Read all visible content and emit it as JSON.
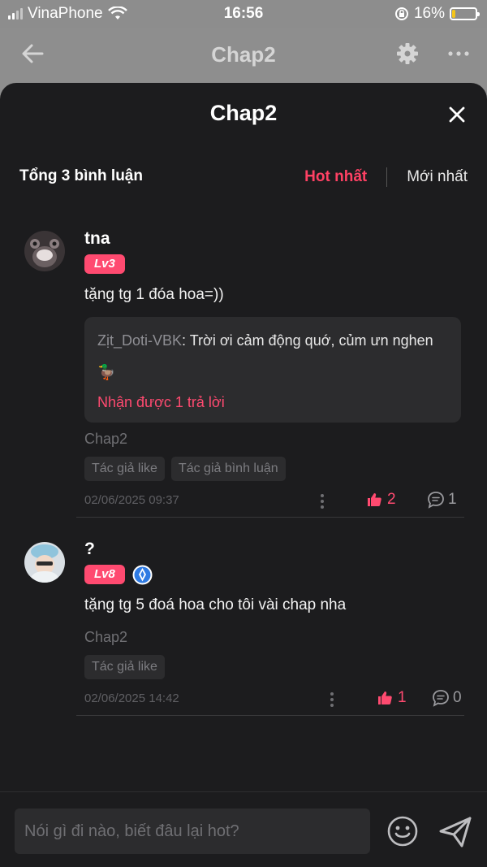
{
  "status": {
    "carrier": "VinaPhone",
    "time": "16:56",
    "battery": "16%",
    "battery_level": 0.16
  },
  "nav": {
    "title": "Chap2"
  },
  "sheet": {
    "title": "Chap2",
    "total_label": "Tổng 3 bình luận",
    "sort_hot": "Hot nhất",
    "sort_new": "Mới nhất"
  },
  "comments": [
    {
      "username": "tna",
      "level": "Lv3",
      "text": "tặng tg 1 đóa hoa=))",
      "reply": {
        "name": "Zịt_Doti-VBK",
        "text": ": Trời ơi cảm động quớ, củm ưn nghen🦆",
        "count_label": "Nhận được 1 trả lời"
      },
      "chapter": "Chap2",
      "tags": [
        "Tác giả like",
        "Tác giả bình luận"
      ],
      "date": "02/06/2025 09:37",
      "likes": "2",
      "replies": "1"
    },
    {
      "username": "?",
      "level": "Lv8",
      "text": "tặng tg 5 đoá hoa cho tôi vài chap nha",
      "chapter": "Chap2",
      "tags": [
        "Tác giả like"
      ],
      "date": "02/06/2025 14:42",
      "likes": "1",
      "replies": "0"
    }
  ],
  "input": {
    "placeholder": "Nói gì đi nào, biết đâu lại hot?"
  },
  "colors": {
    "accent": "#ff4a70",
    "sheet_bg": "#1c1c1e",
    "card_bg": "#2c2c2e"
  }
}
